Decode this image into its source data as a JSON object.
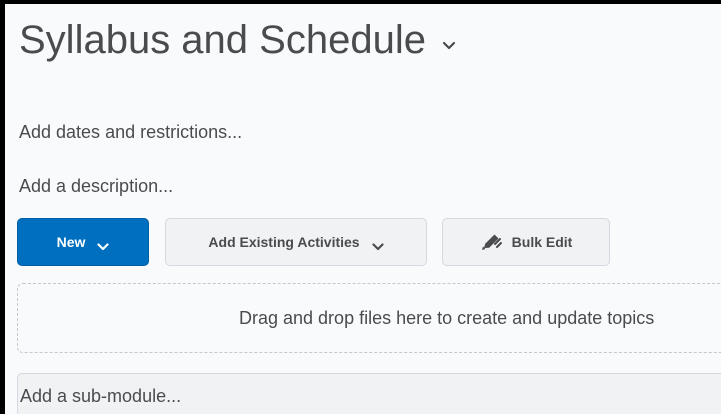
{
  "module": {
    "title": "Syllabus and Schedule",
    "title_menu_icon": "chevron-down-icon",
    "add_dates_link": "Add dates and restrictions...",
    "add_description_link": "Add a description..."
  },
  "toolbar": {
    "new_label": "New",
    "new_icon": "chevron-down-icon",
    "add_existing_label": "Add Existing Activities",
    "add_existing_icon": "chevron-down-icon",
    "bulk_edit_label": "Bulk Edit",
    "bulk_edit_icon": "pencil-icon"
  },
  "dropzone": {
    "text": "Drag and drop files here to create and update topics"
  },
  "submodule": {
    "label": "Add a sub-module..."
  },
  "colors": {
    "primary": "#006fbf",
    "text": "#494c4e",
    "background": "#f9fafb",
    "button_secondary": "#f1f2f3"
  }
}
